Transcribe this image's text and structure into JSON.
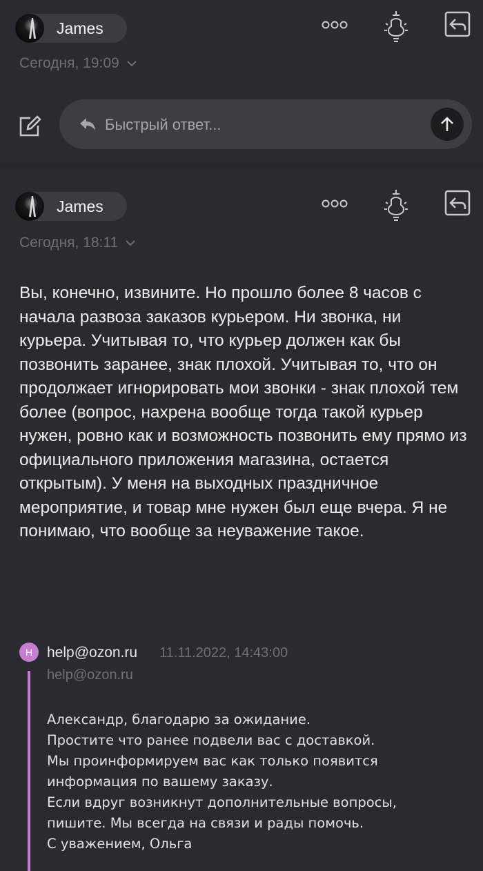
{
  "message1": {
    "sender": "James",
    "date": "Сегодня, 19:09"
  },
  "quick_reply": {
    "placeholder": "Быстрый ответ..."
  },
  "message2": {
    "sender": "James",
    "date": "Сегодня, 18:11",
    "body": "Вы, конечно, извините. Но прошло более 8 часов с начала развоза заказов курьером. Ни звонка, ни курьера. Учитывая то, что курьер должен как бы позвонить заранее, знак плохой. Учитывая то, что он продолжает игнорировать мои звонки - знак плохой тем более (вопрос, нахрена вообще тогда такой курьер нужен, ровно как и возможность позвонить ему прямо из официального приложения магазина, остается открытым). У меня на выходных праздничное мероприятие, и товар мне нужен был еще вчера. Я не понимаю, что вообще за неуважение такое."
  },
  "quoted": {
    "avatar_letter": "H",
    "from": "help@ozon.ru",
    "date": "11.11.2022, 14:43:00",
    "address": "help@ozon.ru",
    "lines": [
      "Александр, благодарю за ожидание.",
      "Простите что ранее подвели вас с доставкой.",
      "Мы проинформируем вас как только появится",
      "информация по вашему заказу.",
      "Если вдруг возникнут дополнительные вопросы,",
      "пишите. Мы всегда на связи и рады помочь.",
      "С уважением, Ольга"
    ]
  },
  "colors": {
    "background": "#2a2b31",
    "pill": "#3b3c43",
    "muted": "#6e6f76",
    "quote_accent": "#c77bd0"
  }
}
